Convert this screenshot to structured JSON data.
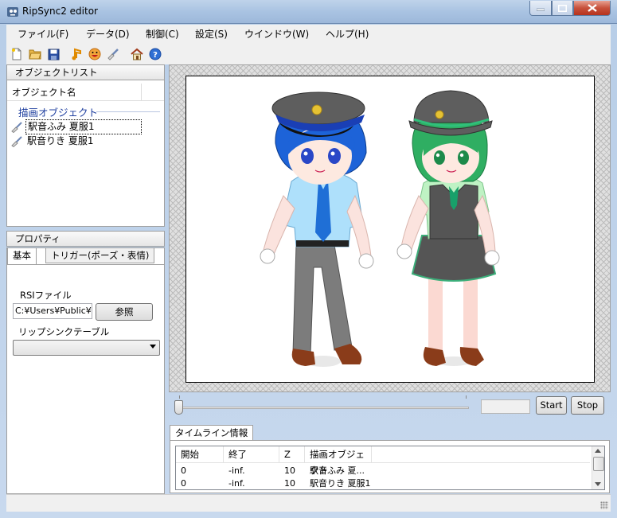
{
  "window": {
    "title": "RipSync2 editor"
  },
  "colors": {
    "accent": "#1f3f9f",
    "titlebar": "#a9c3e2",
    "close": "#c7513c"
  },
  "menu": [
    {
      "label": "ファイル(F)"
    },
    {
      "label": "データ(D)"
    },
    {
      "label": "制御(C)"
    },
    {
      "label": "設定(S)"
    },
    {
      "label": "ウインドウ(W)"
    },
    {
      "label": "ヘルプ(H)"
    }
  ],
  "toolbar": [
    "new-file-icon",
    "open-folder-icon",
    "save-icon",
    "music-note-icon",
    "face-icon",
    "brush-icon",
    "home-icon",
    "help-icon"
  ],
  "object_list": {
    "header": "オブジェクトリスト",
    "column": "オブジェクト名",
    "group": "描画オブジェクト",
    "items": [
      {
        "label": "駅音ふみ 夏服1"
      },
      {
        "label": "駅音りき 夏服1"
      }
    ]
  },
  "properties": {
    "header": "プロパティ",
    "tabs": [
      {
        "label": "基本"
      },
      {
        "label": "トリガー(ポーズ・表情)"
      }
    ],
    "rsi_label": "RSIファイル",
    "rsi_value": "C:¥Users¥Public¥D",
    "browse_label": "参照",
    "lip_label": "リップシンクテーブル",
    "lip_value": ""
  },
  "playback": {
    "time": "",
    "start_label": "Start",
    "stop_label": "Stop"
  },
  "timeline": {
    "tab": "タイムライン情報",
    "columns": [
      "開始",
      "終了",
      "Z",
      "描画オブジェクト"
    ],
    "rows": [
      [
        "0",
        "-inf.",
        "10",
        "駅音ふみ 夏..."
      ],
      [
        "0",
        "-inf.",
        "10",
        "駅音りき 夏服1"
      ]
    ]
  }
}
